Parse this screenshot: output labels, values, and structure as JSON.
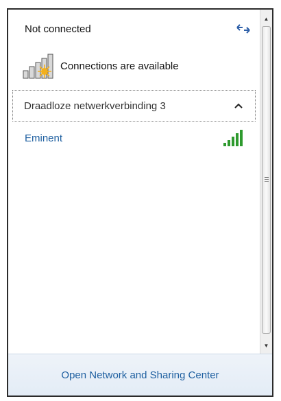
{
  "status": {
    "text": "Not connected"
  },
  "availability": {
    "text": "Connections are available",
    "icon": "network-available-icon",
    "accent": "#f2b01e"
  },
  "refresh": {
    "icon": "refresh-arrows-icon"
  },
  "group": {
    "label": "Draadloze netwerkverbinding 3",
    "state": "expanded",
    "icon": "chevron-up-icon"
  },
  "networks": [
    {
      "name": "Eminent",
      "signal_bars": 5,
      "signal_color": "#2e9a2e",
      "icon": "wifi-signal-icon"
    }
  ],
  "footer": {
    "link": "Open Network and Sharing Center"
  },
  "colors": {
    "link": "#1e5fa0",
    "footer_bg": "#e9f0f8"
  }
}
